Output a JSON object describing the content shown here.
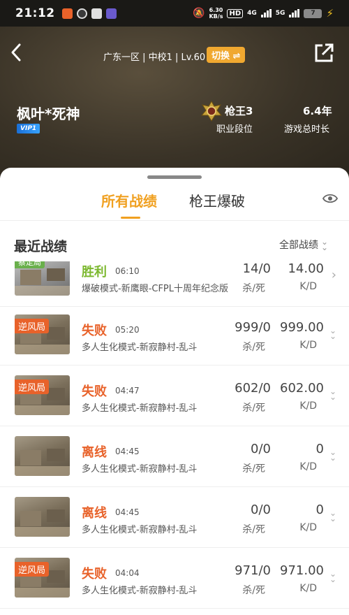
{
  "status": {
    "time": "21:12",
    "speed_top": "6.30",
    "speed_bottom": "KB/s",
    "hd": "HD",
    "net1": "4G",
    "net2": "5G",
    "battery": "7"
  },
  "header": {
    "server_line": "广东一区 | 中校1 | Lv.60",
    "switch_label": "切换 ⇌",
    "player_name": "枫叶*死神",
    "vip": "VIP1",
    "rank_name": "枪王3",
    "rank_label": "职业段位",
    "play_time": "6.4年",
    "play_time_label": "游戏总时长"
  },
  "tabs": [
    {
      "label": "所有战绩"
    },
    {
      "label": "枪王爆破"
    }
  ],
  "section": {
    "title": "最近战绩",
    "filter": "全部战绩"
  },
  "matches": [
    {
      "tag": "蔡定局",
      "result": "胜利",
      "result_type": "win",
      "time": "06:10",
      "mode": "爆破模式-新鹰眼-CFPL十周年纪念版",
      "kd_ratio": "14/0",
      "kd_ratio_label": "杀/死",
      "kd": "14.00",
      "kd_label": "K/D",
      "thumb": "grey"
    },
    {
      "tag": "逆风局",
      "result": "失败",
      "result_type": "lose",
      "time": "05:20",
      "mode": "多人生化模式-新寂静村-乱斗",
      "kd_ratio": "999/0",
      "kd_ratio_label": "杀/死",
      "kd": "999.00",
      "kd_label": "K/D",
      "thumb": "desert"
    },
    {
      "tag": "逆风局",
      "result": "失败",
      "result_type": "lose",
      "time": "04:47",
      "mode": "多人生化模式-新寂静村-乱斗",
      "kd_ratio": "602/0",
      "kd_ratio_label": "杀/死",
      "kd": "602.00",
      "kd_label": "K/D",
      "thumb": "desert"
    },
    {
      "tag": "",
      "result": "离线",
      "result_type": "offline",
      "time": "04:45",
      "mode": "多人生化模式-新寂静村-乱斗",
      "kd_ratio": "0/0",
      "kd_ratio_label": "杀/死",
      "kd": "0",
      "kd_label": "K/D",
      "thumb": "desert"
    },
    {
      "tag": "",
      "result": "离线",
      "result_type": "offline",
      "time": "04:45",
      "mode": "多人生化模式-新寂静村-乱斗",
      "kd_ratio": "0/0",
      "kd_ratio_label": "杀/死",
      "kd": "0",
      "kd_label": "K/D",
      "thumb": "desert"
    },
    {
      "tag": "逆风局",
      "result": "失败",
      "result_type": "lose",
      "time": "04:04",
      "mode": "多人生化模式-新寂静村-乱斗",
      "kd_ratio": "971/0",
      "kd_ratio_label": "杀/死",
      "kd": "971.00",
      "kd_label": "K/D",
      "thumb": "desert"
    }
  ]
}
